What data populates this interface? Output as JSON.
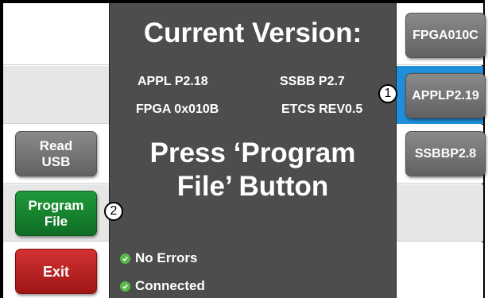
{
  "overlay": {
    "title": "Current Version:",
    "versions": {
      "appl": "APPL P2.18",
      "ssbb": "SSBB P2.7",
      "fpga": "FPGA 0x010B",
      "etcs": "ETCS REV0.5"
    },
    "instruction_line1": "Press ‘Program",
    "instruction_line2": "File’ Button",
    "status": [
      {
        "label": "No Errors"
      },
      {
        "label": "Connected"
      }
    ]
  },
  "left_buttons": {
    "read_usb_line1": "Read",
    "read_usb_line2": "USB",
    "program_file_line1": "Program",
    "program_file_line2": "File",
    "exit": "Exit"
  },
  "right_buttons": {
    "fpga": "FPGA010C",
    "appl": "APPLP2.19",
    "ssbb": "SSBBP2.8"
  },
  "callouts": {
    "one": "1",
    "two": "2"
  },
  "colors": {
    "overlay_bg": "#4d4d4d",
    "highlight_blue": "#1e8fd8",
    "program_green": "#15832e",
    "exit_red": "#c02424",
    "status_check_green": "#58b947"
  }
}
